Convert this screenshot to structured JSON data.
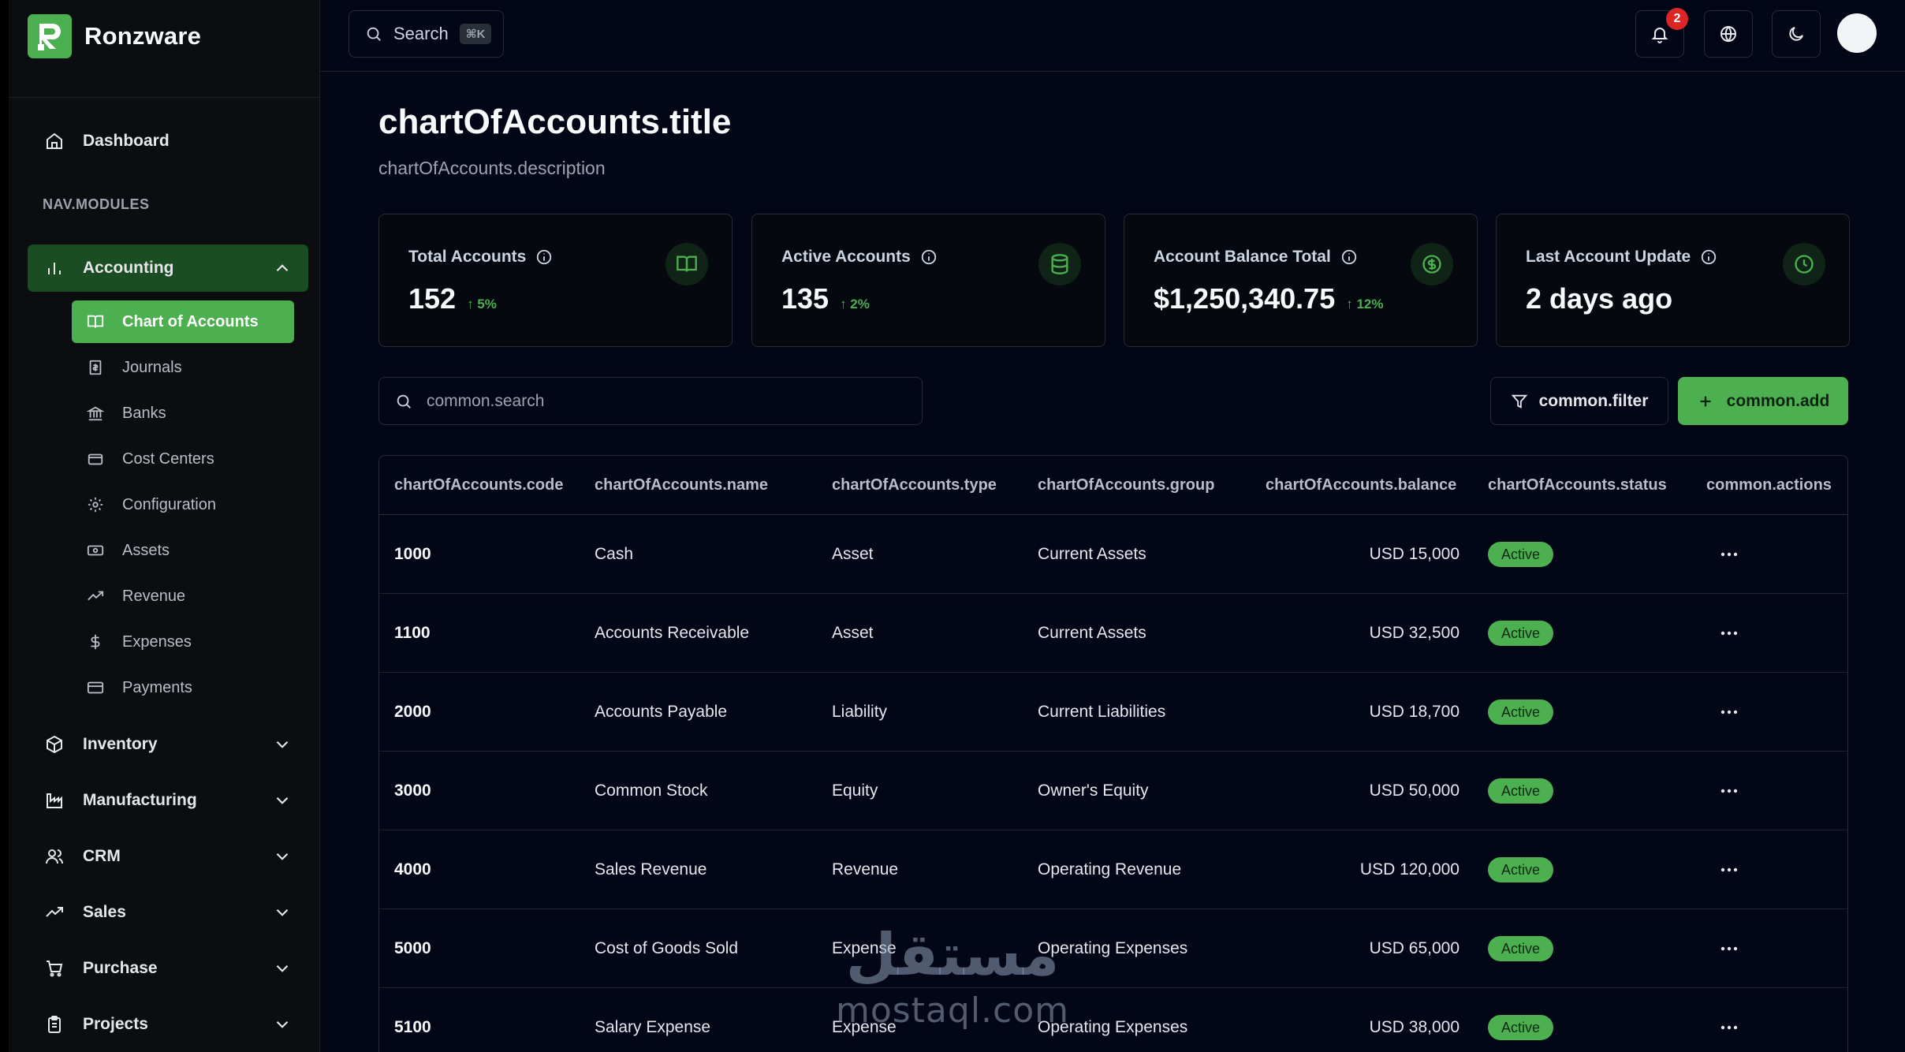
{
  "brand": {
    "name": "Ronzware"
  },
  "sidebar": {
    "dashboard": "Dashboard",
    "section_label": "NAV.MODULES",
    "accounting": "Accounting",
    "sub_items": [
      "Chart of Accounts",
      "Journals",
      "Banks",
      "Cost Centers",
      "Configuration",
      "Assets",
      "Revenue",
      "Expenses",
      "Payments"
    ],
    "modules": [
      "Inventory",
      "Manufacturing",
      "CRM",
      "Sales",
      "Purchase",
      "Projects"
    ]
  },
  "topbar": {
    "search_label": "Search",
    "search_shortcut": "⌘K",
    "notification_count": "2"
  },
  "page": {
    "title": "chartOfAccounts.title",
    "description": "chartOfAccounts.description"
  },
  "stats": [
    {
      "label": "Total Accounts",
      "value": "152",
      "change": "↑ 5%",
      "icon": "book-icon"
    },
    {
      "label": "Active Accounts",
      "value": "135",
      "change": "↑ 2%",
      "icon": "database-icon"
    },
    {
      "label": "Account Balance Total",
      "value": "$1,250,340.75",
      "change": "↑ 12%",
      "icon": "dollar-circle-icon"
    },
    {
      "label": "Last Account Update",
      "value": "2 days ago",
      "change": "",
      "icon": "clock-icon"
    }
  ],
  "toolbar": {
    "search_placeholder": "common.search",
    "filter_label": "common.filter",
    "add_label": "common.add"
  },
  "table": {
    "columns": [
      "chartOfAccounts.code",
      "chartOfAccounts.name",
      "chartOfAccounts.type",
      "chartOfAccounts.group",
      "chartOfAccounts.balance",
      "chartOfAccounts.status",
      "common.actions"
    ],
    "rows": [
      {
        "code": "1000",
        "name": "Cash",
        "type": "Asset",
        "group": "Current Assets",
        "balance": "USD 15,000",
        "status": "Active"
      },
      {
        "code": "1100",
        "name": "Accounts Receivable",
        "type": "Asset",
        "group": "Current Assets",
        "balance": "USD 32,500",
        "status": "Active"
      },
      {
        "code": "2000",
        "name": "Accounts Payable",
        "type": "Liability",
        "group": "Current Liabilities",
        "balance": "USD 18,700",
        "status": "Active"
      },
      {
        "code": "3000",
        "name": "Common Stock",
        "type": "Equity",
        "group": "Owner's Equity",
        "balance": "USD 50,000",
        "status": "Active"
      },
      {
        "code": "4000",
        "name": "Sales Revenue",
        "type": "Revenue",
        "group": "Operating Revenue",
        "balance": "USD 120,000",
        "status": "Active"
      },
      {
        "code": "5000",
        "name": "Cost of Goods Sold",
        "type": "Expense",
        "group": "Operating Expenses",
        "balance": "USD 65,000",
        "status": "Active"
      },
      {
        "code": "5100",
        "name": "Salary Expense",
        "type": "Expense",
        "group": "Operating Expenses",
        "balance": "USD 38,000",
        "status": "Active"
      }
    ]
  },
  "watermark": {
    "arabic": "مستقل",
    "latin": "mostaql.com"
  },
  "colors": {
    "accent": "#4caf50",
    "background": "#020617",
    "sidebar": "#0b0d10",
    "badge": "#dc2626"
  }
}
